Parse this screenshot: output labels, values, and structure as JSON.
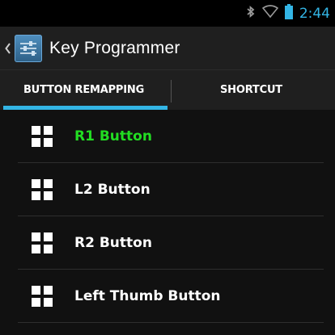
{
  "status_bar": {
    "time": "2:44",
    "icons": [
      "bluetooth-icon",
      "wifi-icon",
      "battery-icon"
    ]
  },
  "action_bar": {
    "title": "Key Programmer",
    "icon": "app-sliders-icon"
  },
  "tabs": [
    {
      "label": "BUTTON REMAPPING",
      "selected": true
    },
    {
      "label": "SHORTCUT",
      "selected": false
    }
  ],
  "list": {
    "items": [
      {
        "label": "R1 Button",
        "color": "#22dd22",
        "icon": "grid-icon"
      },
      {
        "label": "L2 Button",
        "color": "#ffffff",
        "icon": "grid-icon"
      },
      {
        "label": "R2 Button",
        "color": "#ffffff",
        "icon": "grid-icon"
      },
      {
        "label": "Left Thumb Button",
        "color": "#ffffff",
        "icon": "grid-icon"
      }
    ]
  },
  "colors": {
    "accent": "#33b5e5",
    "highlight_text": "#22dd22",
    "background": "#111111"
  }
}
